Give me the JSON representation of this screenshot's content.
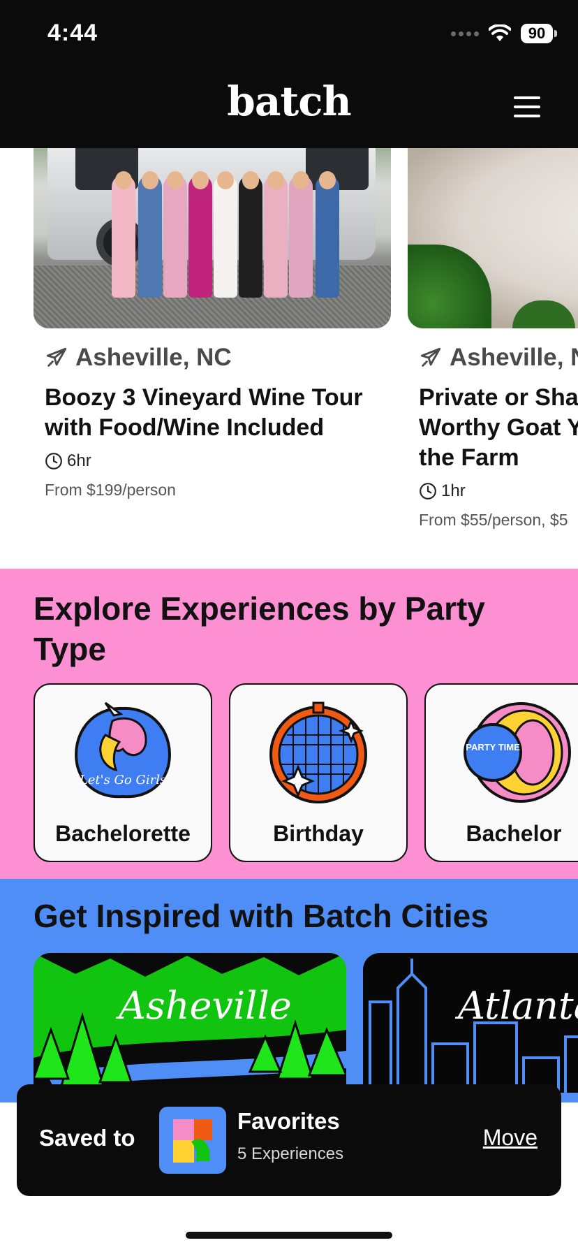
{
  "status_bar": {
    "time": "4:44",
    "battery": "90"
  },
  "header": {
    "logo": "batch",
    "menu_icon": "hamburger-menu-icon"
  },
  "experiences": [
    {
      "location": "Asheville, NC",
      "title": "Boozy 3 Vineyard Wine Tour with Food/Wine Included",
      "duration": "6hr",
      "price": "From $199/person"
    },
    {
      "location": "Asheville, N",
      "title": "Private or Sha Worthy Goat Y on the Farm",
      "duration": "1hr",
      "price": "From $55/person, $5"
    }
  ],
  "party_section": {
    "title": "Explore Experiences by Party Type",
    "types": [
      {
        "label": "Bachelorette",
        "badge_text": "Let's Go Girls"
      },
      {
        "label": "Birthday"
      },
      {
        "label": "Bachelor",
        "badge_text": "PARTY TIME"
      }
    ]
  },
  "cities_section": {
    "title": "Get Inspired with Batch Cities",
    "cities": [
      {
        "name": "Asheville"
      },
      {
        "name": "Atlanta"
      }
    ]
  },
  "toast": {
    "saved_label": "Saved to",
    "collection": "Favorites",
    "count": "5 Experiences",
    "move_label": "Move"
  },
  "colors": {
    "header_bg": "#0b0b0c",
    "party_bg": "#fd90d3",
    "cities_bg": "#4f8ef6",
    "asheville_green": "#10c40f"
  }
}
